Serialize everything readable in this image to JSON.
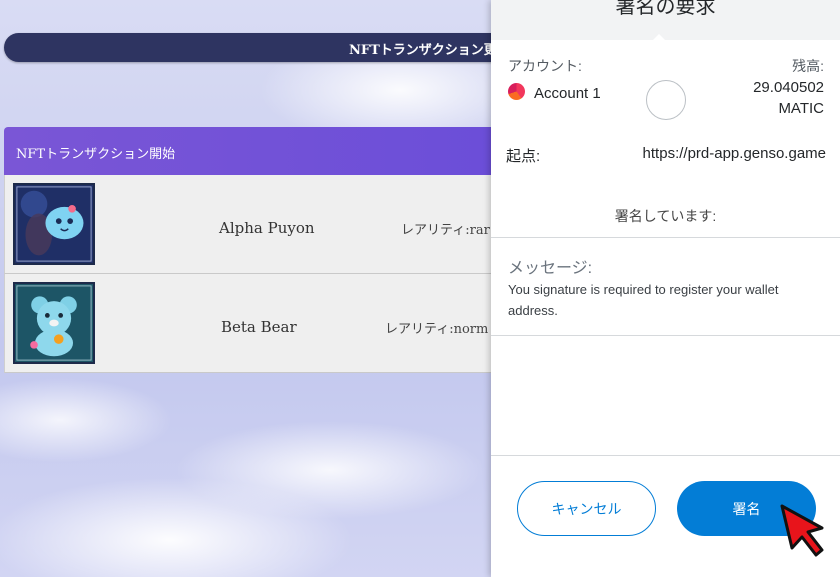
{
  "progress": {
    "label": "NFTトランザクション更新"
  },
  "nft_panel": {
    "header": "NFTトランザクション開始",
    "items": [
      {
        "name": "Alpha Puyon",
        "rarity": "レアリティ:rar"
      },
      {
        "name": "Beta Bear",
        "rarity": "レアリティ:norm"
      }
    ]
  },
  "popup": {
    "title": "署名の要求",
    "account_label": "アカウント:",
    "balance_label": "残高:",
    "account_name": "Account 1",
    "balance_value": "29.040502",
    "balance_unit": "MATIC",
    "origin_label": "起点:",
    "origin_url": "https://prd-app.genso.game",
    "signing_text": "署名しています:",
    "message_label": "メッセージ:",
    "message_text": "You signature is required to register your wallet address.",
    "cancel_label": "キャンセル",
    "sign_label": "署名",
    "accent_color": "#037dd6"
  }
}
